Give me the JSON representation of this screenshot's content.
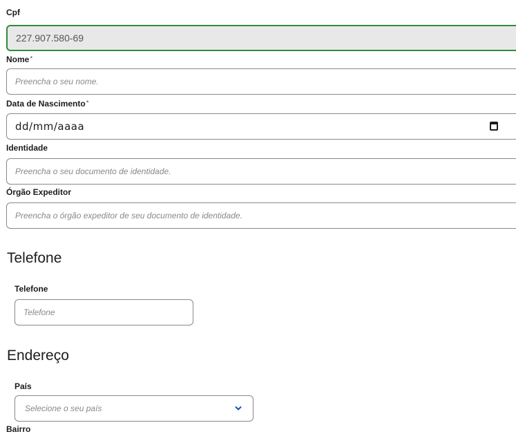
{
  "cpf": {
    "label": "Cpf",
    "value": "227.907.580-69"
  },
  "nome": {
    "label": "Nome",
    "required_mark": "*",
    "placeholder": "Preencha o seu nome."
  },
  "nascimento": {
    "label": "Data de Nascimento",
    "required_mark": "*",
    "value": "dd/mm/aaaa",
    "icon": "calendar-icon"
  },
  "identidade": {
    "label": "Identidade",
    "placeholder": "Preencha o seu documento de identidade."
  },
  "orgao": {
    "label": "Órgão Expeditor",
    "placeholder": "Preencha o órgão expeditor de seu documento de identidade."
  },
  "telefone_section": {
    "title": "Telefone",
    "label": "Telefone",
    "placeholder": "Telefone"
  },
  "endereco_section": {
    "title": "Endereço",
    "pais_label": "País",
    "pais_placeholder": "Selecione o seu país",
    "bairro_label": "Bairro"
  },
  "colors": {
    "readonly_border": "#2e8b3a",
    "readonly_bg": "#e8e8e8",
    "chevron": "#1351b4"
  }
}
